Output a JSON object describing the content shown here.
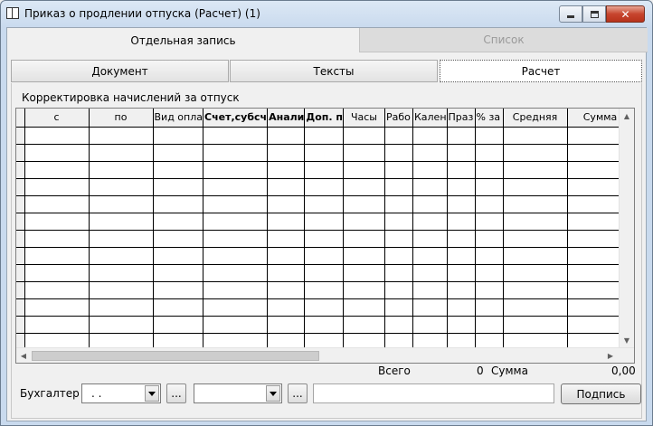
{
  "window": {
    "title": "Приказ о продлении отпуска (Расчет) (1)",
    "close_glyph": "✕"
  },
  "top_tabs": [
    {
      "label": "Отдельная запись",
      "active": true
    },
    {
      "label": "Список",
      "active": false
    }
  ],
  "sub_tabs": [
    {
      "label": "Документ",
      "active": false
    },
    {
      "label": "Тексты",
      "active": false
    },
    {
      "label": "Расчет",
      "active": true
    }
  ],
  "section": {
    "label": "Корректировка начислений за отпуск"
  },
  "grid": {
    "columns": [
      "с",
      "по",
      "Вид опла",
      "Счет,субсч",
      "Анали",
      "Доп. п",
      "Часы",
      "Рабо",
      "Кален",
      "Праз",
      "% за",
      "Средняя",
      "Сумма"
    ],
    "row_count": 13
  },
  "totals": {
    "total_label": "Всего",
    "total_value": "0",
    "sum_label": "Сумма",
    "sum_value": "0,00"
  },
  "form": {
    "accountant_label": "Бухгалтер",
    "accountant_value": ". .",
    "second_combo_value": "",
    "ellipsis_label": "...",
    "text_value": "",
    "sign_button": "Подпись"
  },
  "colors": {
    "title_bar": "#c9daee",
    "close_button": "#c7452e",
    "window_bg": "#f0f0f0"
  }
}
